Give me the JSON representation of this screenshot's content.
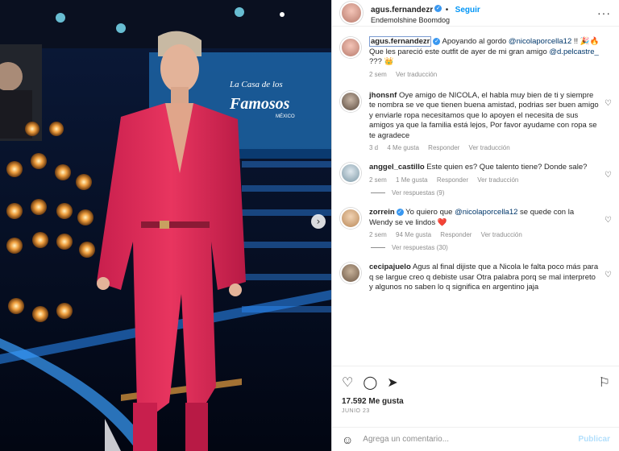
{
  "photo": {
    "show_title_1": "La Casa de los",
    "show_title_2": "Famosos",
    "show_title_3": "MÉXICO",
    "next_icon": "chevron-right-icon"
  },
  "header": {
    "username": "agus.fernandezr",
    "follow": "Seguir",
    "subtitle": "Endemolshine Boomdog",
    "more": "···"
  },
  "caption": {
    "username": "agus.fernandezr",
    "text_1": "Apoyando al gordo ",
    "mention_1": "@nicolaporcella12",
    "text_2": " !! 🎉🔥Que les pareció este outfit de ayer de mi gran amigo ",
    "mention_2": "@d.pelcastre_",
    "text_3": " ??? 👑",
    "time": "2 sem",
    "translate": "Ver traducción"
  },
  "comments": [
    {
      "username": "jhonsnf",
      "text": "Oye amigo de NICOLA, el habla muy bien de ti y siempre te nombra se ve que tienen buena amistad, podrias ser buen amigo y enviarle ropa necesitamos que lo apoyen el necesita de sus amigos ya que la familia está lejos, Por favor ayudame con ropa se te agradece",
      "time": "3 d",
      "likes": "4 Me gusta",
      "reply": "Responder",
      "translate": "Ver traducción"
    },
    {
      "username": "anggel_castillo",
      "text": "Este quien es? Que talento tiene? Donde sale?",
      "time": "2 sem",
      "likes": "1 Me gusta",
      "reply": "Responder",
      "translate": "Ver traducción",
      "replies": "Ver respuestas (9)"
    },
    {
      "username": "zorrein",
      "text_1": "Yo quiero que ",
      "mention": "@nicolaporcella12",
      "text_2": " se quede con la Wendy se ve lindos ❤️",
      "time": "2 sem",
      "likes": "94 Me gusta",
      "reply": "Responder",
      "translate": "Ver traducción",
      "replies": "Ver respuestas (30)"
    },
    {
      "username": "cecipajuelo",
      "text": "Agus al final dijiste que a Nicola le falta poco más para q se largue creo q debiste usar Otra palabra porq se mal interpreto y algunos no saben lo q significa en argentino jaja"
    }
  ],
  "actions": {
    "like_icon": "heart-icon",
    "comment_icon": "comment-icon",
    "share_icon": "share-icon",
    "save_icon": "bookmark-icon",
    "likes": "17.592 Me gusta",
    "date": "JUNIO 23"
  },
  "add_comment": {
    "emoji_icon": "emoji-icon",
    "placeholder": "Agrega un comentario...",
    "post": "Publicar"
  }
}
